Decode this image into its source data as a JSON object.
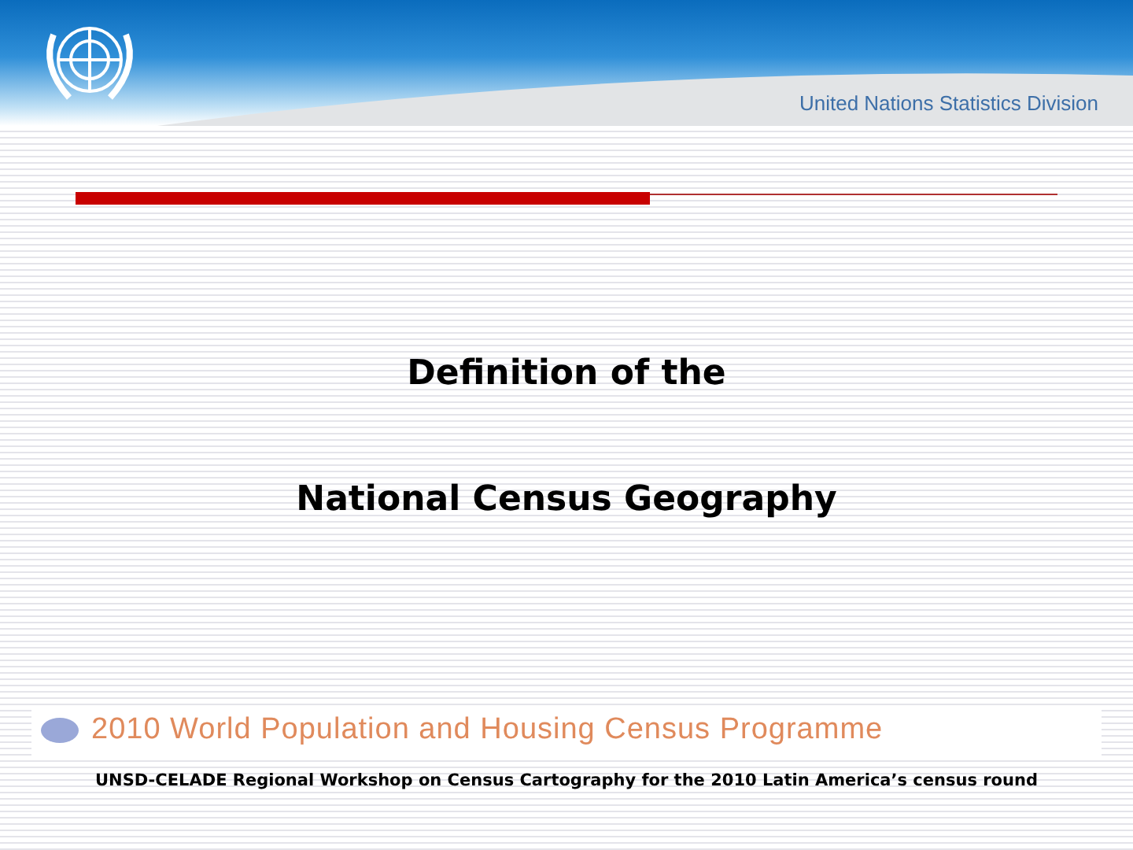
{
  "header": {
    "organization": "United Nations Statistics Division"
  },
  "title_lines": [
    "Definition of the",
    "National Census Geography"
  ],
  "banner": {
    "text": "2010 World Population and Housing Census Programme"
  },
  "footer": {
    "text": "UNSD-CELADE Regional Workshop on Census Cartography for the 2010 Latin America’s census round"
  }
}
